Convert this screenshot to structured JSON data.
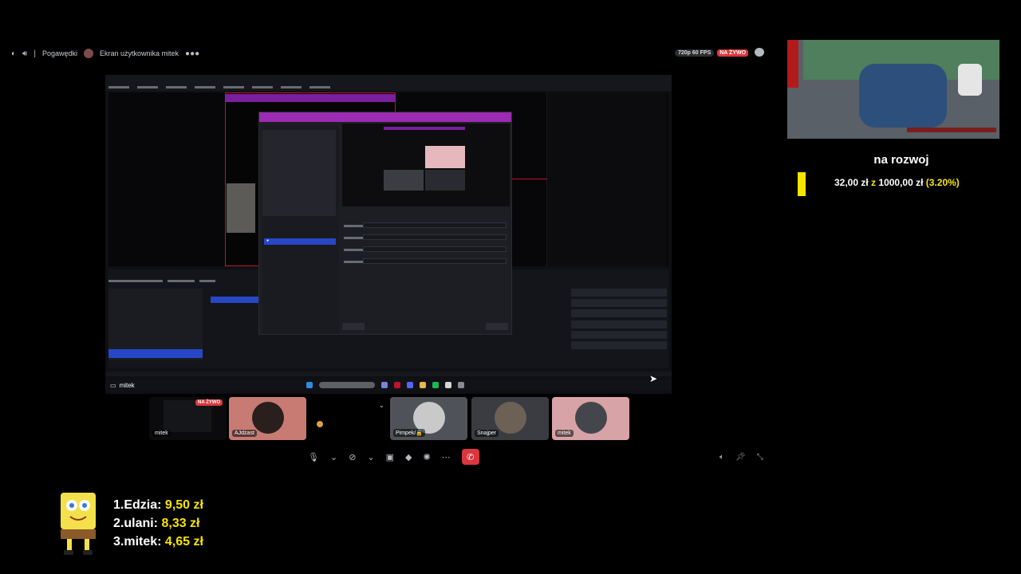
{
  "topbar": {
    "channel_category": "Pogawędki",
    "screen_title": "Ekran użytkownika mitek",
    "quality_badge": "720p 60 FPS",
    "live_badge": "NA ŻYWO"
  },
  "screen": {
    "label": "mitek",
    "filter_dialog": {
      "source_item": "Przechwytywanie okna"
    }
  },
  "participants": [
    {
      "name": "mitek",
      "live_badge": "NA ŻYWO"
    },
    {
      "name": "AJdżast"
    },
    {
      "name": "Pimpek/🔒"
    },
    {
      "name": "Snajper"
    },
    {
      "name": "mitek"
    }
  ],
  "goal": {
    "title": "na rozwoj",
    "current": "32,00 zł",
    "connector": "z",
    "target": "1000,00 zł",
    "percent": "(3.20%)"
  },
  "leaderboard": [
    {
      "rank": "1.",
      "name": "Edzia:",
      "amount": "9,50 zł"
    },
    {
      "rank": "2.",
      "name": "ulani:",
      "amount": "8,33 zł"
    },
    {
      "rank": "3.",
      "name": "mitek:",
      "amount": "4,65 zł"
    }
  ],
  "colors": {
    "live_red": "#da373c",
    "goal_yellow": "#f5e400",
    "selection_blue": "#2847c7",
    "dialog_title_purple": "#9b2bb0"
  }
}
